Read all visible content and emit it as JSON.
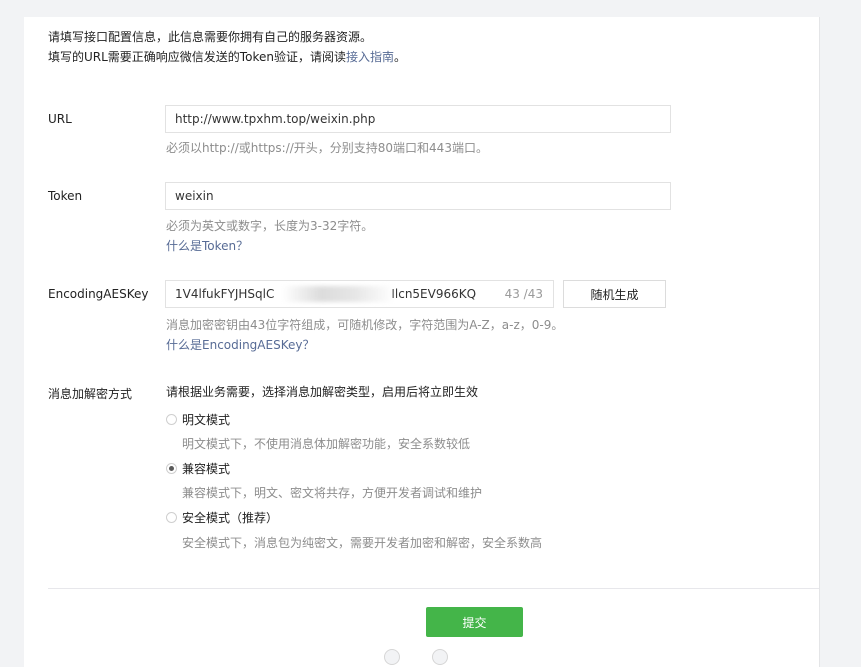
{
  "intro": {
    "line1": "请填写接口配置信息，此信息需要你拥有自己的服务器资源。",
    "line2_prefix": "填写的URL需要正确响应微信发送的Token验证，请阅读",
    "line2_link": "接入指南",
    "line2_suffix": "。"
  },
  "url": {
    "label": "URL",
    "value": "http://www.tpxhm.top/weixin.php",
    "hint": "必须以http://或https://开头，分别支持80端口和443端口。"
  },
  "token": {
    "label": "Token",
    "value": "weixin",
    "hint": "必须为英文或数字，长度为3-32字符。",
    "link": "什么是Token？"
  },
  "aes": {
    "label": "EncodingAESKey",
    "value_visible_start": "1V4lfukFYJHSqlC",
    "value_visible_end": "Ilcn5EV966KQ",
    "counter": "43 /43",
    "generate_button": "随机生成",
    "hint": "消息加密密钥由43位字符组成，可随机修改，字符范围为A-Z，a-z，0-9。",
    "link": "什么是EncodingAESKey？"
  },
  "encryption": {
    "label": "消息加解密方式",
    "description": "请根据业务需要，选择消息加解密类型，启用后将立即生效",
    "options": [
      {
        "label": "明文模式",
        "desc": "明文模式下，不使用消息体加解密功能，安全系数较低",
        "checked": false
      },
      {
        "label": "兼容模式",
        "desc": "兼容模式下，明文、密文将共存，方便开发者调试和维护",
        "checked": true
      },
      {
        "label": "安全模式（推荐）",
        "desc": "安全模式下，消息包为纯密文，需要开发者加密和解密，安全系数高",
        "checked": false
      }
    ]
  },
  "submit_button": "提交",
  "colors": {
    "primary": "#44b549",
    "link": "#576b95",
    "hint": "#8d8d8d"
  }
}
